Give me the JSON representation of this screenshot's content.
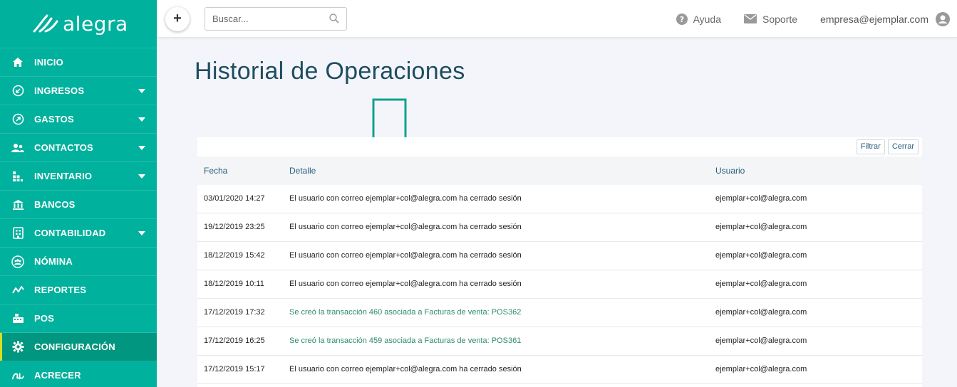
{
  "app": {
    "logo_text": "alegra"
  },
  "sidebar": {
    "items": [
      {
        "label": "INICIO",
        "icon": "home-icon",
        "has_caret": false
      },
      {
        "label": "INGRESOS",
        "icon": "income-icon",
        "has_caret": true
      },
      {
        "label": "GASTOS",
        "icon": "expenses-icon",
        "has_caret": true
      },
      {
        "label": "CONTACTOS",
        "icon": "contacts-icon",
        "has_caret": true
      },
      {
        "label": "INVENTARIO",
        "icon": "inventory-icon",
        "has_caret": true
      },
      {
        "label": "BANCOS",
        "icon": "bank-icon",
        "has_caret": false
      },
      {
        "label": "CONTABILIDAD",
        "icon": "accounting-icon",
        "has_caret": true
      },
      {
        "label": "NÓMINA",
        "icon": "payroll-icon",
        "has_caret": false
      },
      {
        "label": "REPORTES",
        "icon": "reports-icon",
        "has_caret": false
      },
      {
        "label": "POS",
        "icon": "pos-icon",
        "has_caret": false
      },
      {
        "label": "CONFIGURACIÓN",
        "icon": "gear-icon",
        "has_caret": false,
        "active": true
      },
      {
        "label": "ACRECER",
        "icon": "acrecer-icon",
        "has_caret": false
      }
    ]
  },
  "topbar": {
    "add_label": "+",
    "search_placeholder": "Buscar...",
    "help_label": "Ayuda",
    "support_label": "Soporte",
    "user_email": "empresa@ejemplar.com"
  },
  "main": {
    "title": "Historial de Operaciones",
    "filter_label": "Filtrar",
    "close_label": "Cerrar",
    "columns": [
      "Fecha",
      "Detalle",
      "Usuario"
    ],
    "rows": [
      {
        "fecha": "03/01/2020 14:27",
        "detalle": "El usuario con correo ejemplar+col@alegra.com ha cerrado sesión",
        "usuario": "ejemplar+col@alegra.com",
        "link": false
      },
      {
        "fecha": "19/12/2019 23:25",
        "detalle": "El usuario con correo ejemplar+col@alegra.com ha cerrado sesión",
        "usuario": "ejemplar+col@alegra.com",
        "link": false
      },
      {
        "fecha": "18/12/2019 15:42",
        "detalle": "El usuario con correo ejemplar+col@alegra.com ha cerrado sesión",
        "usuario": "ejemplar+col@alegra.com",
        "link": false
      },
      {
        "fecha": "18/12/2019 10:11",
        "detalle": "El usuario con correo ejemplar+col@alegra.com ha cerrado sesión",
        "usuario": "ejemplar+col@alegra.com",
        "link": false
      },
      {
        "fecha": "17/12/2019 17:32",
        "detalle": "Se creó la transacción 460 asociada a Facturas de venta: POS362",
        "usuario": "ejemplar+col@alegra.com",
        "link": true
      },
      {
        "fecha": "17/12/2019 16:25",
        "detalle": "Se creó la transacción 459 asociada a Facturas de venta: POS361",
        "usuario": "ejemplar+col@alegra.com",
        "link": true
      },
      {
        "fecha": "17/12/2019 15:17",
        "detalle": "El usuario con correo ejemplar+col@alegra.com ha cerrado sesión",
        "usuario": "ejemplar+col@alegra.com",
        "link": false
      }
    ]
  },
  "colors": {
    "sidebar": "#00b19d",
    "sidebar_active": "#00967f",
    "accent_bar": "#d7df23",
    "title": "#1e4d5f",
    "link": "#2b8a6e"
  }
}
